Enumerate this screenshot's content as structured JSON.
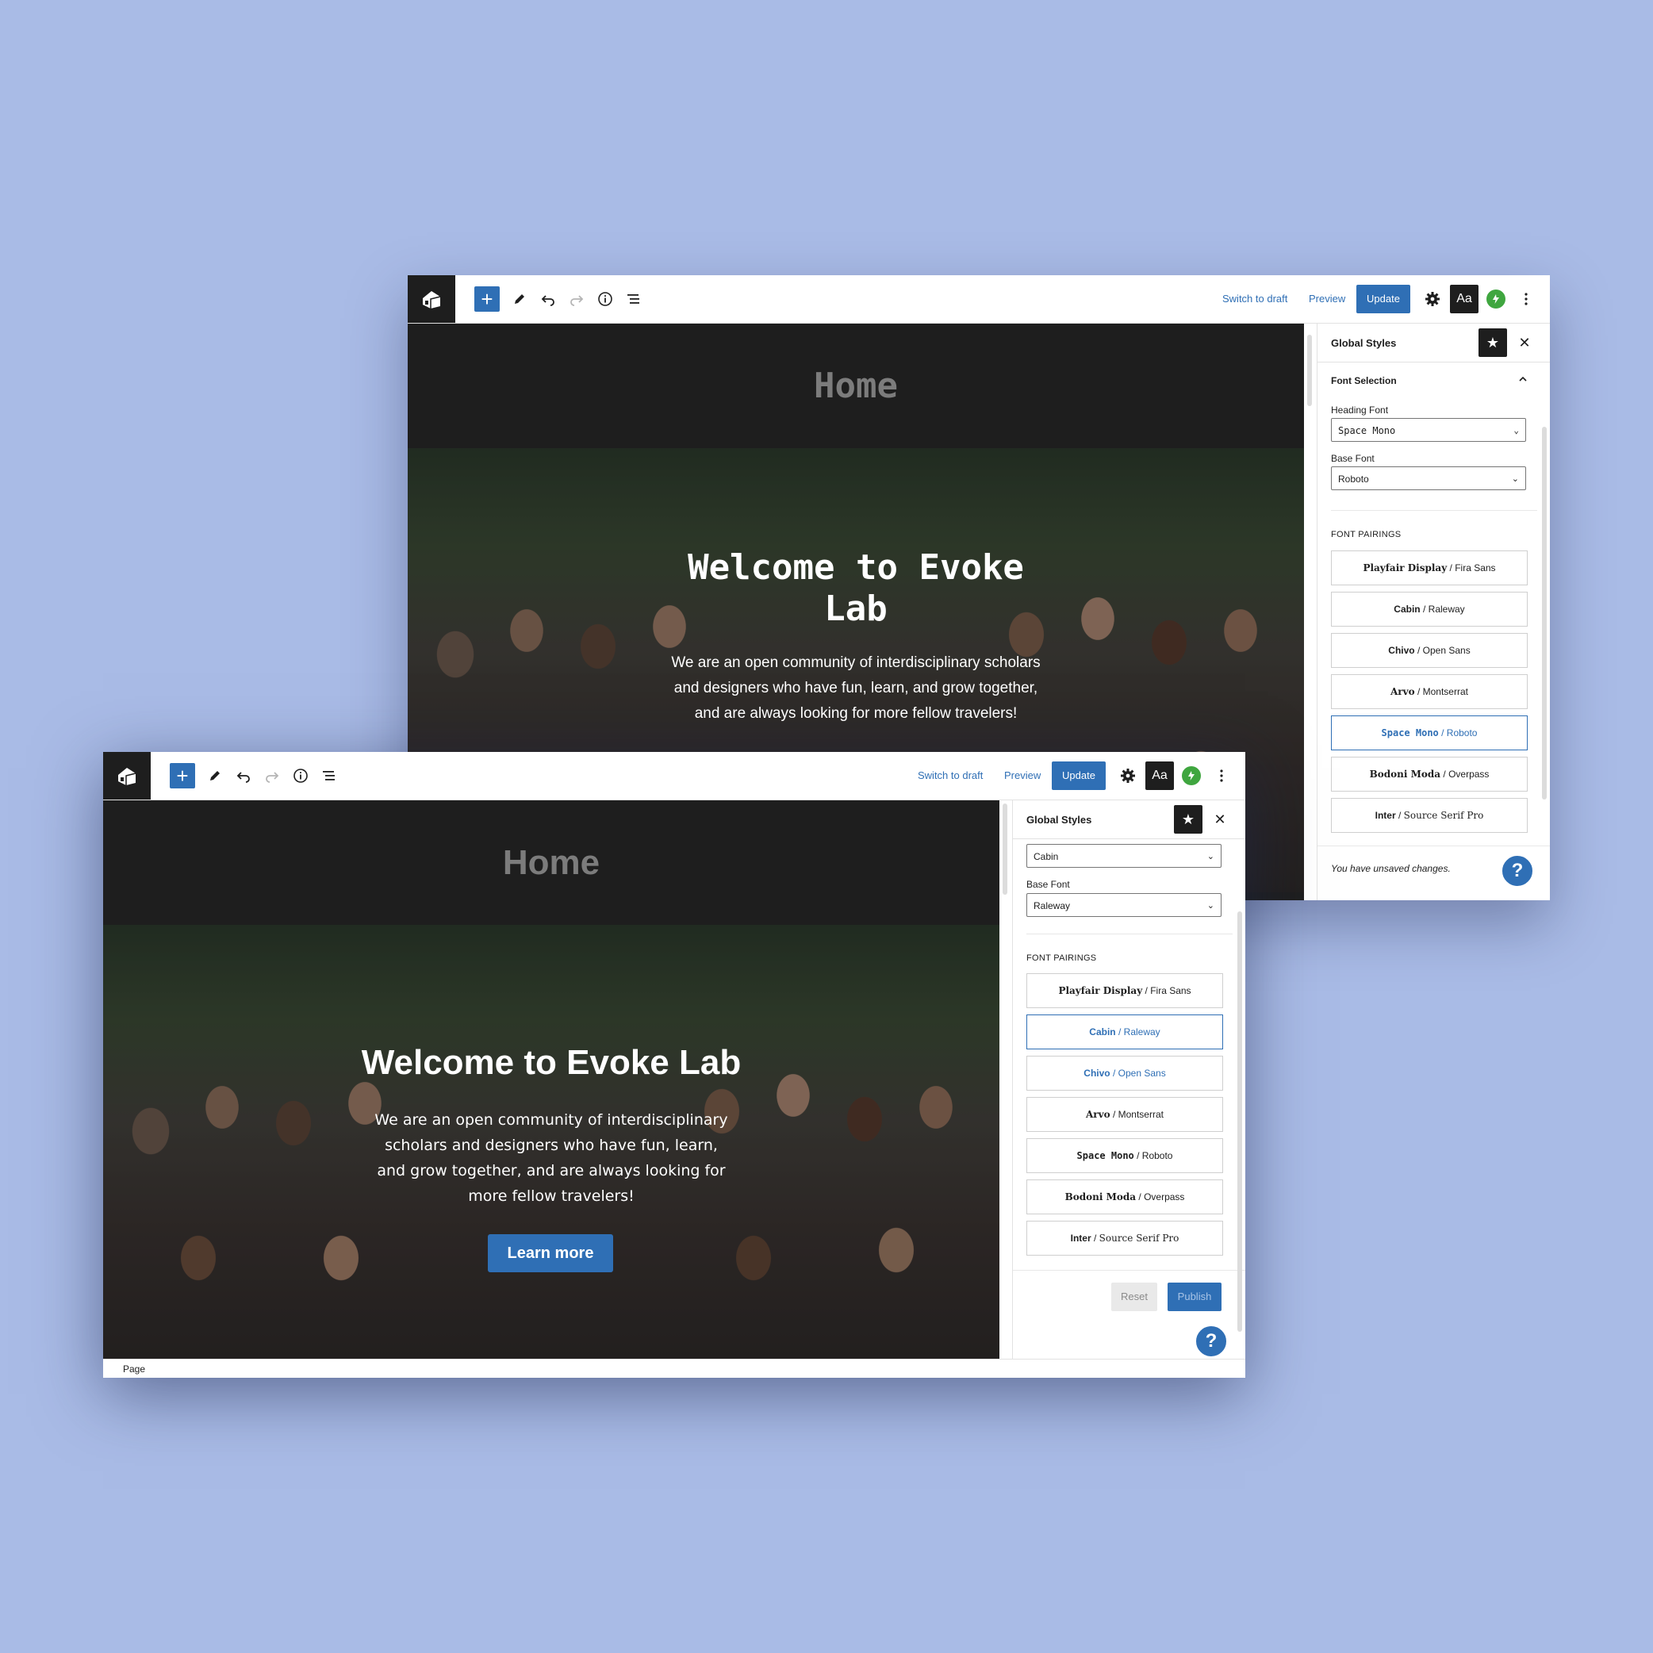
{
  "background_color": "#a9bbe6",
  "accent_color": "#2f6fb5",
  "back_window": {
    "toolbar": {
      "switch_to_draft": "Switch to draft",
      "preview": "Preview",
      "update": "Update",
      "aa": "Aa"
    },
    "page_heading": "Home",
    "hero": {
      "title": "Welcome to Evoke Lab",
      "text": "We are an open community of interdisciplinary scholars and designers who have fun, learn, and grow together, and are always looking for more fellow travelers!"
    },
    "panel": {
      "title": "Global Styles",
      "section_title": "Font Selection",
      "heading_font_label": "Heading Font",
      "heading_font_value": "Space Mono",
      "base_font_label": "Base Font",
      "base_font_value": "Roboto",
      "pairings_title": "FONT PAIRINGS",
      "pairings": [
        {
          "heading": "Playfair Display",
          "base": "Fira Sans"
        },
        {
          "heading": "Cabin",
          "base": "Raleway"
        },
        {
          "heading": "Chivo",
          "base": "Open Sans"
        },
        {
          "heading": "Arvo",
          "base": "Montserrat"
        },
        {
          "heading": "Space Mono",
          "base": "Roboto"
        },
        {
          "heading": "Bodoni Moda",
          "base": "Overpass"
        },
        {
          "heading": "Inter",
          "base": "Source Serif Pro"
        }
      ],
      "active_pairing": "Space Mono / Roboto",
      "unsaved_notice": "You have unsaved changes.",
      "help": "?"
    }
  },
  "front_window": {
    "toolbar": {
      "switch_to_draft": "Switch to draft",
      "preview": "Preview",
      "update": "Update",
      "aa": "Aa"
    },
    "page_heading": "Home",
    "hero": {
      "title": "Welcome to Evoke Lab",
      "text": "We are an open community of interdisciplinary scholars and designers who have fun, learn, and grow together, and are always looking for more fellow travelers!",
      "button": "Learn more"
    },
    "panel": {
      "title": "Global Styles",
      "heading_font_value": "Cabin",
      "base_font_label": "Base Font",
      "base_font_value": "Raleway",
      "pairings_title": "FONT PAIRINGS",
      "pairings": [
        {
          "heading": "Playfair Display",
          "base": "Fira Sans"
        },
        {
          "heading": "Cabin",
          "base": "Raleway"
        },
        {
          "heading": "Chivo",
          "base": "Open Sans"
        },
        {
          "heading": "Arvo",
          "base": "Montserrat"
        },
        {
          "heading": "Space Mono",
          "base": "Roboto"
        },
        {
          "heading": "Bodoni Moda",
          "base": "Overpass"
        },
        {
          "heading": "Inter",
          "base": "Source Serif Pro"
        }
      ],
      "active_pairing": "Cabin / Raleway",
      "reset": "Reset",
      "publish": "Publish",
      "help": "?"
    },
    "status_bar": "Page"
  }
}
